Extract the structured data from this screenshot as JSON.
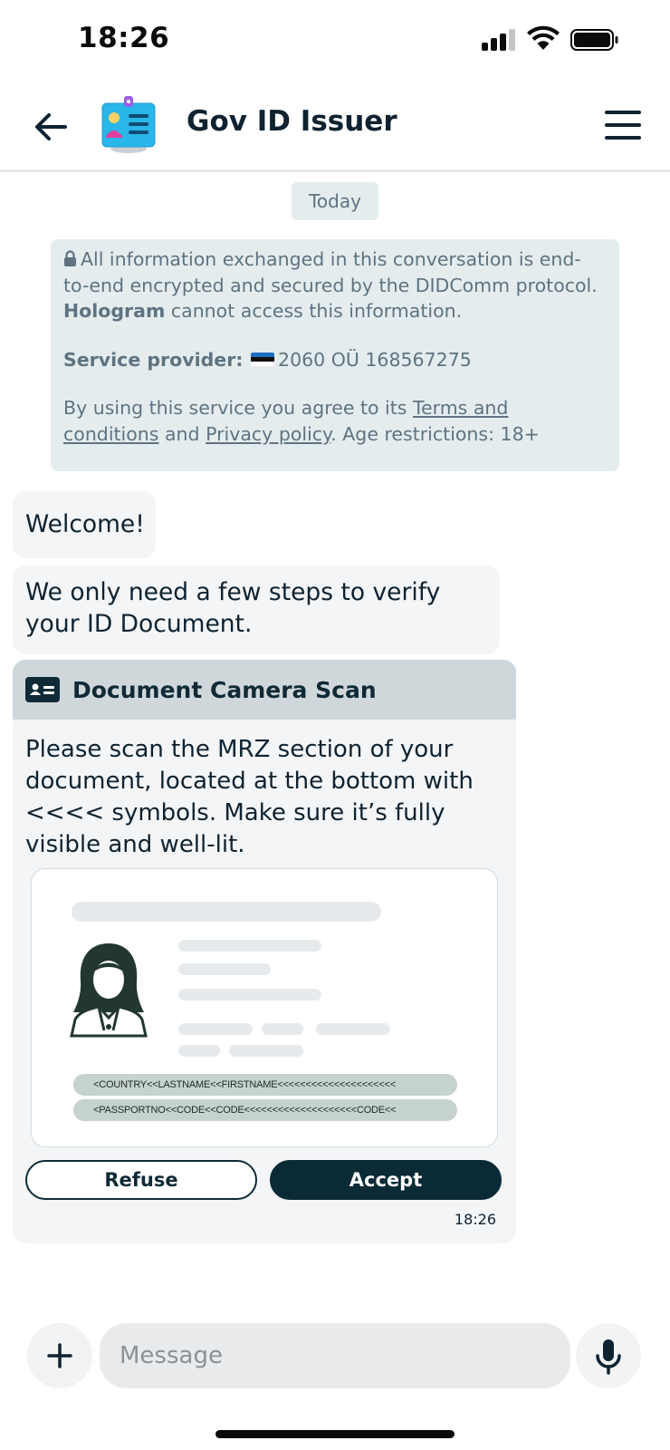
{
  "status_bar": {
    "time": "18:26"
  },
  "header": {
    "title": "Gov ID Issuer",
    "back_icon": "arrow-left-icon",
    "menu_icon": "hamburger-menu-icon"
  },
  "conversation": {
    "date_label": "Today",
    "info": {
      "encryption_pre": "All information exchanged in this conversation is end-to-end encrypted and secured by the DIDComm protocol. ",
      "encryption_app": "Hologram",
      "encryption_post": " cannot access this information.",
      "provider_label": "Service provider:",
      "provider_value": "2060 OÜ 168567275",
      "terms_pre": "By using this service you agree to its ",
      "terms_link": "Terms and conditions",
      "terms_mid": " and ",
      "privacy_link": "Privacy policy",
      "terms_post": ". Age restrictions: 18+"
    },
    "messages": [
      {
        "text": "Welcome!"
      },
      {
        "text": "We only need a few steps to verify your ID Document."
      }
    ],
    "card": {
      "title": "Document Camera Scan",
      "body": "Please scan the MRZ section of your document, located at the bottom with <<<< symbols. Make sure it’s fully visible and well-lit.",
      "mrz_line_1": "<COUNTRY<<LASTNAME<<FIRSTNAME<<<<<<<<<<<<<<<<<<<<<",
      "mrz_line_2": "<PASSPORTNO<<CODE<<CODE<<<<<<<<<<<<<<<<<<<<CODE<<",
      "refuse_label": "Refuse",
      "accept_label": "Accept",
      "time": "18:26"
    }
  },
  "composer": {
    "placeholder": "Message",
    "add_icon": "plus-icon",
    "mic_icon": "microphone-icon"
  },
  "colors": {
    "primary_dark": "#0a2a36",
    "info_bg": "#e4ecee",
    "bubble_bg": "#f3f5f7",
    "card_header_bg": "#cfd7db"
  }
}
